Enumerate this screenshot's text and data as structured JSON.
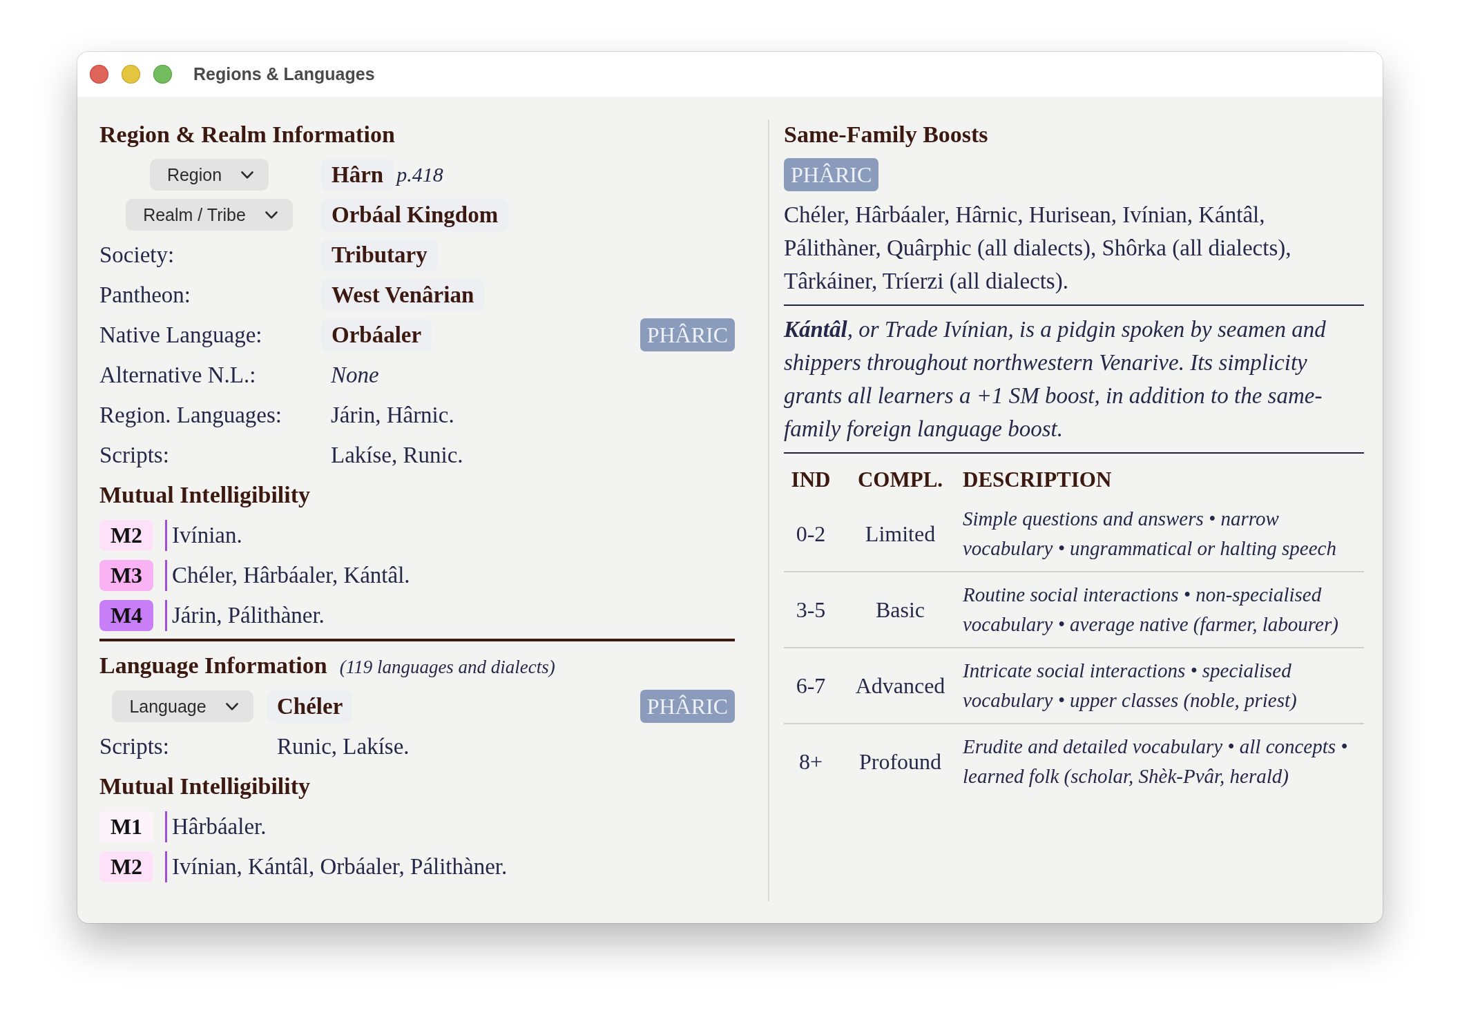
{
  "window": {
    "title": "Regions & Languages"
  },
  "region_realm": {
    "title": "Region & Realm Information",
    "fields": [
      {
        "kind": "select",
        "label": "Region",
        "value": "Hârn",
        "note": "p.418"
      },
      {
        "kind": "select",
        "label": "Realm / Tribe",
        "value": "Orbáal Kingdom"
      },
      {
        "kind": "emphasis",
        "label": "Society:",
        "value": "Tributary"
      },
      {
        "kind": "emphasis",
        "label": "Pantheon:",
        "value": "West Venârian"
      },
      {
        "kind": "emphasis",
        "label": "Native Language:",
        "value": "Orbáaler",
        "family": "PHÂRIC"
      },
      {
        "kind": "unset",
        "label": "Alternative N.L.:",
        "value": "None"
      },
      {
        "kind": "plain",
        "label": "Region. Languages:",
        "value": "Járin, Hârnic."
      },
      {
        "kind": "plain",
        "label": "Scripts:",
        "value": "Lakíse, Runic."
      }
    ],
    "mutual_title": "Mutual Intelligibility",
    "mutual": [
      {
        "grade": "M2",
        "color": "#fde1f9",
        "languages": "Ivínian."
      },
      {
        "grade": "M3",
        "color": "#f9b2f3",
        "languages": "Chéler, Hârbáaler, Kántâl."
      },
      {
        "grade": "M4",
        "color": "#c77ef7",
        "languages": "Járin, Pálithàner."
      }
    ]
  },
  "language_info": {
    "title": "Language Information",
    "count": "(119 languages and dialects)",
    "fields": [
      {
        "kind": "select",
        "label": "Language",
        "value": "Chéler",
        "family": "PHÂRIC"
      },
      {
        "kind": "plain",
        "label": "Scripts:",
        "value": "Runic, Lakíse."
      }
    ],
    "mutual_title": "Mutual Intelligibility",
    "mutual": [
      {
        "grade": "M1",
        "color": "#fdf3fb",
        "languages": "Hârbáaler."
      },
      {
        "grade": "M2",
        "color": "#fde1f9",
        "languages": "Ivínian, Kántâl, Orbáaler, Pálithàner."
      }
    ]
  },
  "same_family_boosts": {
    "title": "Same-Family Boosts",
    "family": "PHÂRIC",
    "members": "Chéler, Hârbáaler, Hârnic, Hurisean, Ivínian, Kántâl, Pálithàner, Quârphic (all dialects), Shôrka (all dialects), Târkáiner, Tríerzi (all dialects).",
    "note": "**Kántâl**, or Trade Ivínian, is a pidgin spoken by seamen and shippers throughout northwestern Venarive. Its simplicity grants all learners a +1 SM boost, in addition to the same-family foreign language boost."
  },
  "competence_table": {
    "columns": [
      "IND",
      "COMPL.",
      "DESCRIPTION"
    ],
    "rows": [
      {
        "ind": "0-2",
        "competence": "Limited",
        "description": "Simple questions and answers • narrow vocabulary • ungrammatical or halting speech"
      },
      {
        "ind": "3-5",
        "competence": "Basic",
        "description": "Routine social interactions • non-specialised vocabulary • average native (farmer, labourer)"
      },
      {
        "ind": "6-7",
        "competence": "Advanced",
        "description": "Intricate social interactions • specialised vocabulary • upper classes (noble, priest)"
      },
      {
        "ind": "8+",
        "competence": "Profound",
        "description": "Erudite and detailed vocabulary • all concepts • learned folk (scholar, Shèk-Pvâr, herald)"
      }
    ]
  }
}
